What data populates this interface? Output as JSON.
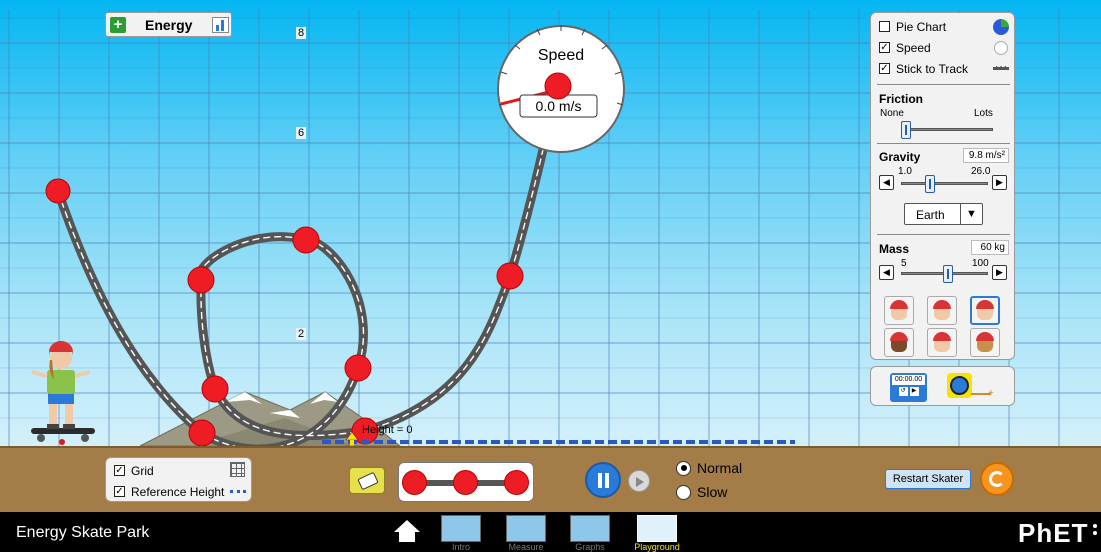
{
  "energy_panel": {
    "title": "Energy",
    "plus_icon": "+",
    "bar_icon": "bar-graph-icon"
  },
  "grid_labels": [
    "8",
    "6",
    "2"
  ],
  "speedometer": {
    "title": "Speed",
    "value": "0.0 m/s"
  },
  "controls": {
    "pie_chart": {
      "label": "Pie Chart",
      "checked": false
    },
    "speed": {
      "label": "Speed",
      "checked": true
    },
    "stick_to_track": {
      "label": "Stick to Track",
      "checked": true
    },
    "friction": {
      "title": "Friction",
      "min_label": "None",
      "max_label": "Lots",
      "level": 0
    },
    "gravity": {
      "title": "Gravity",
      "value": "9.8 m/s²",
      "min_label": "1.0",
      "max_label": "26.0",
      "current": 9.8
    },
    "planet": {
      "selected": "Earth"
    },
    "mass": {
      "title": "Mass",
      "value": "60 kg",
      "min_label": "5",
      "max_label": "100",
      "current": 60
    }
  },
  "height_label": "Height = 0",
  "bottom_left": {
    "grid": {
      "label": "Grid",
      "checked": true
    },
    "reference_height": {
      "label": "Reference Height",
      "checked": true
    }
  },
  "playback": {
    "normal_label": "Normal",
    "slow_label": "Slow",
    "selected": "Normal"
  },
  "restart_label": "Restart Skater",
  "stopwatch_readout": "00:00.00",
  "navbar": {
    "title": "Energy Skate Park",
    "tabs": [
      "Intro",
      "Measure",
      "Graphs",
      "Playground"
    ],
    "active_tab": "Playground",
    "logo": "PhET"
  },
  "colors": {
    "sky_top": "#04b6f2",
    "ground": "#a37c47",
    "accent_blue": "#2a7bd8",
    "restart_orange": "#f7941d",
    "track_node": "#ee1c24"
  }
}
